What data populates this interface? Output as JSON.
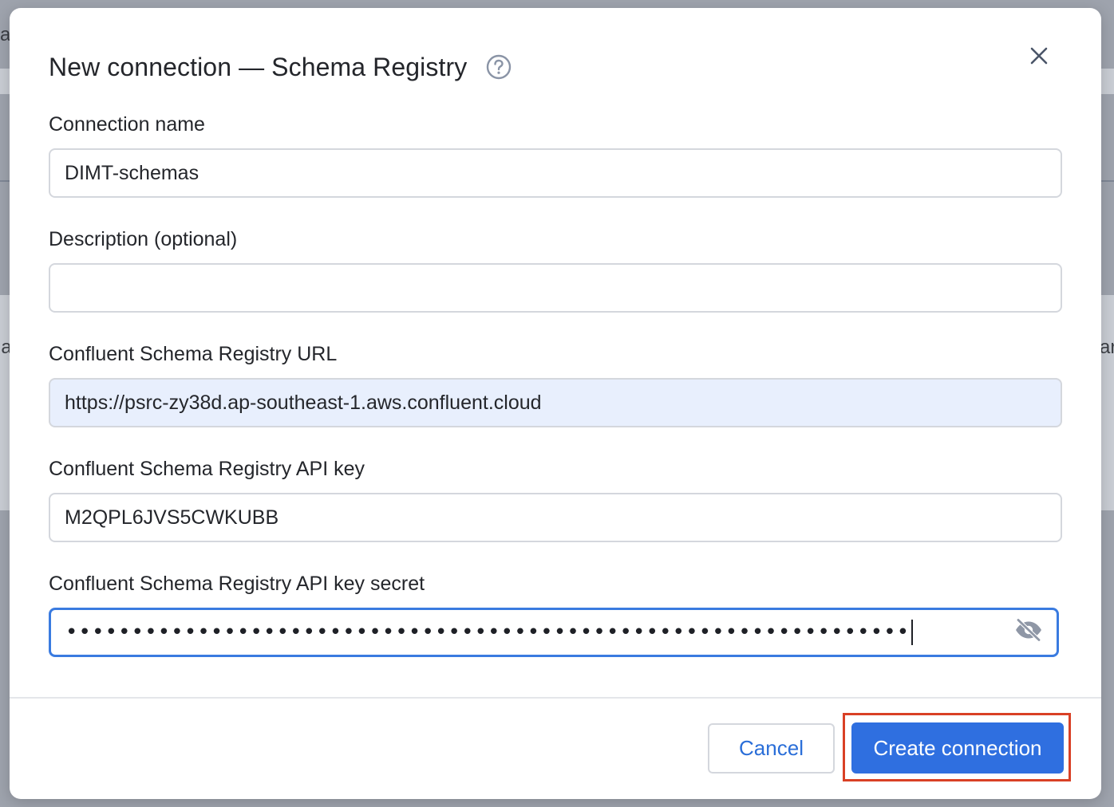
{
  "background": {
    "frag_top_left": "a",
    "frag_mid_left": "na",
    "frag_mid_right": "ar"
  },
  "dialog": {
    "title": "New connection — Schema Registry",
    "help_icon": "question-circle-icon",
    "close_icon": "close-icon"
  },
  "fields": {
    "connection_name": {
      "label": "Connection name",
      "value": "DIMT-schemas"
    },
    "description": {
      "label": "Description (optional)",
      "value": ""
    },
    "registry_url": {
      "label": "Confluent Schema Registry URL",
      "value": "https://psrc-zy38d.ap-southeast-1.aws.confluent.cloud"
    },
    "api_key": {
      "label": "Confluent Schema Registry API key",
      "value": "M2QPL6JVS5CWKUBB"
    },
    "api_secret": {
      "label": "Confluent Schema Registry API key secret",
      "masked_value": "••••••••••••••••••••••••••••••••••••••••••••••••••••••••••••••••",
      "toggle_icon": "eye-off-icon"
    }
  },
  "footer": {
    "cancel_label": "Cancel",
    "create_label": "Create connection"
  },
  "colors": {
    "primary": "#2f6fe0",
    "focus_border": "#3a7be0",
    "autofill_bg": "#e8effd",
    "highlight": "#d94025"
  }
}
